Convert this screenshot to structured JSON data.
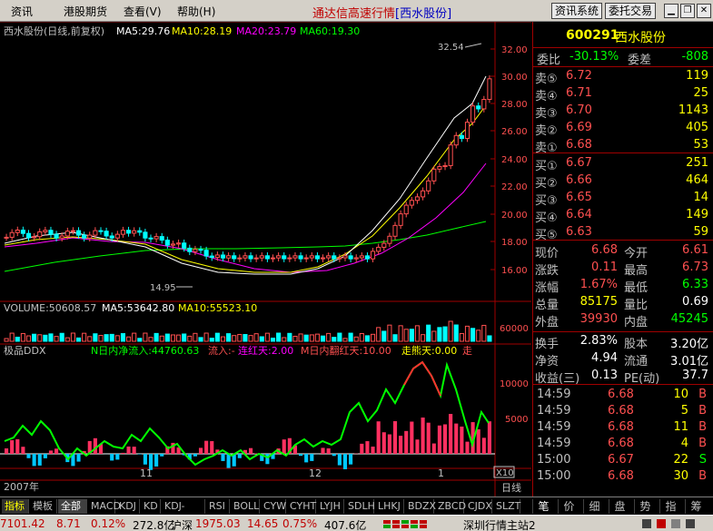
{
  "menu": {
    "items": [
      "资讯",
      "港股期货",
      "查看(V)",
      "帮助(H)"
    ],
    "title_main": "通达信高速行情",
    "title_stock": "[西水股份]",
    "btn_info": "资讯系统",
    "btn_trade": "委托交易"
  },
  "chart": {
    "header_name": "西水股份(日线,前复权)",
    "ma5": "MA5:29.76",
    "ma10": "MA10:28.19",
    "ma20": "MA20:23.79",
    "ma60": "MA60:19.30",
    "high_label": "32.54",
    "low_label": "14.95",
    "volume_header": "VOLUME:50608.57",
    "vol_ma5": "MA5:53642.80",
    "vol_ma10": "MA10:55523.10",
    "vol_tick": "60000",
    "ddx_title": "极品DDX",
    "ddx_net": "N日内净流入:44760.63",
    "ddx_in": "流入:-",
    "ddx_red_days": "连红天:2.00",
    "ddx_m_red": "M日内翻红天:10.00",
    "ddx_weak": "走熊天:0.00",
    "ddx_tail": "走",
    "ddx_ticks": [
      "10000",
      "5000"
    ],
    "x10": "X10",
    "date_labels": [
      "2007年",
      "11",
      "12",
      "1"
    ],
    "date_btn": "日线",
    "price_ticks": [
      "32.00",
      "30.00",
      "28.00",
      "26.00",
      "24.00",
      "22.00",
      "20.00",
      "18.00",
      "16.00"
    ]
  },
  "chart_data": {
    "type": "line",
    "title": "西水股份(日线,前复权)",
    "series": [
      {
        "name": "MA5",
        "value": 29.76
      },
      {
        "name": "MA10",
        "value": 28.19
      },
      {
        "name": "MA20",
        "value": 23.79
      },
      {
        "name": "MA60",
        "value": 19.3
      }
    ],
    "high": 32.54,
    "low": 14.95,
    "ylim": [
      15,
      33
    ]
  },
  "quote": {
    "code": "600291",
    "name": "西水股份",
    "webi_label": "委比",
    "webi_val": "-30.13%",
    "weicha_label": "委差",
    "weicha_val": "-808",
    "sells": [
      {
        "label": "卖⑤",
        "price": "6.72",
        "vol": "119"
      },
      {
        "label": "卖④",
        "price": "6.71",
        "vol": "25"
      },
      {
        "label": "卖③",
        "price": "6.70",
        "vol": "1143"
      },
      {
        "label": "卖②",
        "price": "6.69",
        "vol": "405"
      },
      {
        "label": "卖①",
        "price": "6.68",
        "vol": "53"
      }
    ],
    "buys": [
      {
        "label": "买①",
        "price": "6.67",
        "vol": "251"
      },
      {
        "label": "买②",
        "price": "6.66",
        "vol": "464"
      },
      {
        "label": "买③",
        "price": "6.65",
        "vol": "14"
      },
      {
        "label": "买④",
        "price": "6.64",
        "vol": "149"
      },
      {
        "label": "买⑤",
        "price": "6.63",
        "vol": "59"
      }
    ],
    "stats": [
      {
        "l1": "现价",
        "v1": "6.68",
        "l2": "今开",
        "v2": "6.61",
        "c1": "#ff5050",
        "c2": "#ff5050"
      },
      {
        "l1": "涨跌",
        "v1": "0.11",
        "l2": "最高",
        "v2": "6.73",
        "c1": "#ff5050",
        "c2": "#ff5050"
      },
      {
        "l1": "涨幅",
        "v1": "1.67%",
        "l2": "最低",
        "v2": "6.33",
        "c1": "#ff5050",
        "c2": "#00ff00"
      },
      {
        "l1": "总量",
        "v1": "85175",
        "l2": "量比",
        "v2": "0.69",
        "c1": "#ffff00",
        "c2": "#ffffff"
      },
      {
        "l1": "外盘",
        "v1": "39930",
        "l2": "内盘",
        "v2": "45245",
        "c1": "#ff5050",
        "c2": "#00ff00"
      }
    ],
    "stats2": [
      {
        "l1": "换手",
        "v1": "2.83%",
        "l2": "股本",
        "v2": "3.20亿"
      },
      {
        "l1": "净资",
        "v1": "4.94",
        "l2": "流通",
        "v2": "3.01亿"
      },
      {
        "l1": "收益(三)",
        "v1": "0.13",
        "l2": "PE(动)",
        "v2": "37.7"
      }
    ],
    "ticks": [
      {
        "time": "14:59",
        "price": "6.68",
        "vol": "10",
        "dir": "B"
      },
      {
        "time": "14:59",
        "price": "6.68",
        "vol": "5",
        "dir": "B"
      },
      {
        "time": "14:59",
        "price": "6.68",
        "vol": "11",
        "dir": "B"
      },
      {
        "time": "14:59",
        "price": "6.68",
        "vol": "4",
        "dir": "B"
      },
      {
        "time": "15:00",
        "price": "6.67",
        "vol": "22",
        "dir": "S"
      },
      {
        "time": "15:00",
        "price": "6.68",
        "vol": "30",
        "dir": "B"
      }
    ]
  },
  "tabs": {
    "left": [
      "指标",
      "模板",
      "全部",
      "MACD",
      "KDJ",
      "KD",
      "KDJ-TDX",
      "RSI",
      "BOLL",
      "CYW",
      "CYHT",
      "LYJH",
      "SDLH",
      "LHKJ",
      "BDZX",
      "ZBCD",
      "CJDX",
      "SLZT"
    ],
    "right": [
      "笔",
      "价",
      "细",
      "盘",
      "势",
      "指",
      "筹"
    ]
  },
  "status": {
    "sh_index": "7101.42",
    "sh_change": "8.71",
    "sh_pct": "0.12%",
    "sh_amount": "272.8亿",
    "sz_label": "沪深",
    "sz_index": "1975.03",
    "sz_change": "14.65",
    "sz_pct": "0.75%",
    "sz_amount": "407.6亿",
    "server": "深圳行情主站2"
  },
  "colors": {
    "up": "#ff5050",
    "down": "#00ffff",
    "ma5": "#ffffff",
    "ma10": "#ffff00",
    "ma20": "#ff00ff",
    "ma60": "#00ff00"
  }
}
